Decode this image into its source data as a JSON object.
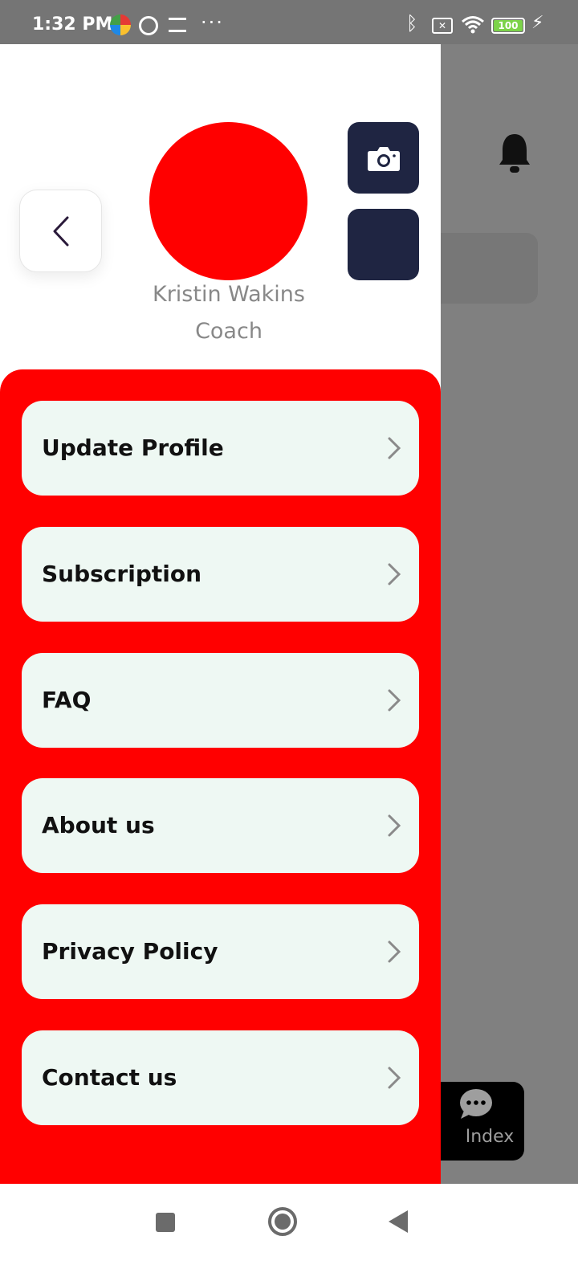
{
  "status_bar": {
    "time": "1:32 PM",
    "overflow_dots": "···",
    "bluetooth": "bluetooth-icon",
    "battery_level": "100",
    "battery_color": "#7cd34a"
  },
  "background": {
    "nav_label": "Index",
    "overlay_color": "#808080"
  },
  "drawer": {
    "user_name": "Kristin Wakins",
    "user_role": "Coach",
    "avatar_color": "#ff0000",
    "panel_color": "#ff0000",
    "button_color": "#1f2542",
    "menu_items": [
      {
        "label": "Update Profile"
      },
      {
        "label": "Subscription"
      },
      {
        "label": "FAQ"
      },
      {
        "label": "About us"
      },
      {
        "label": "Privacy Policy"
      },
      {
        "label": "Contact us"
      }
    ]
  }
}
